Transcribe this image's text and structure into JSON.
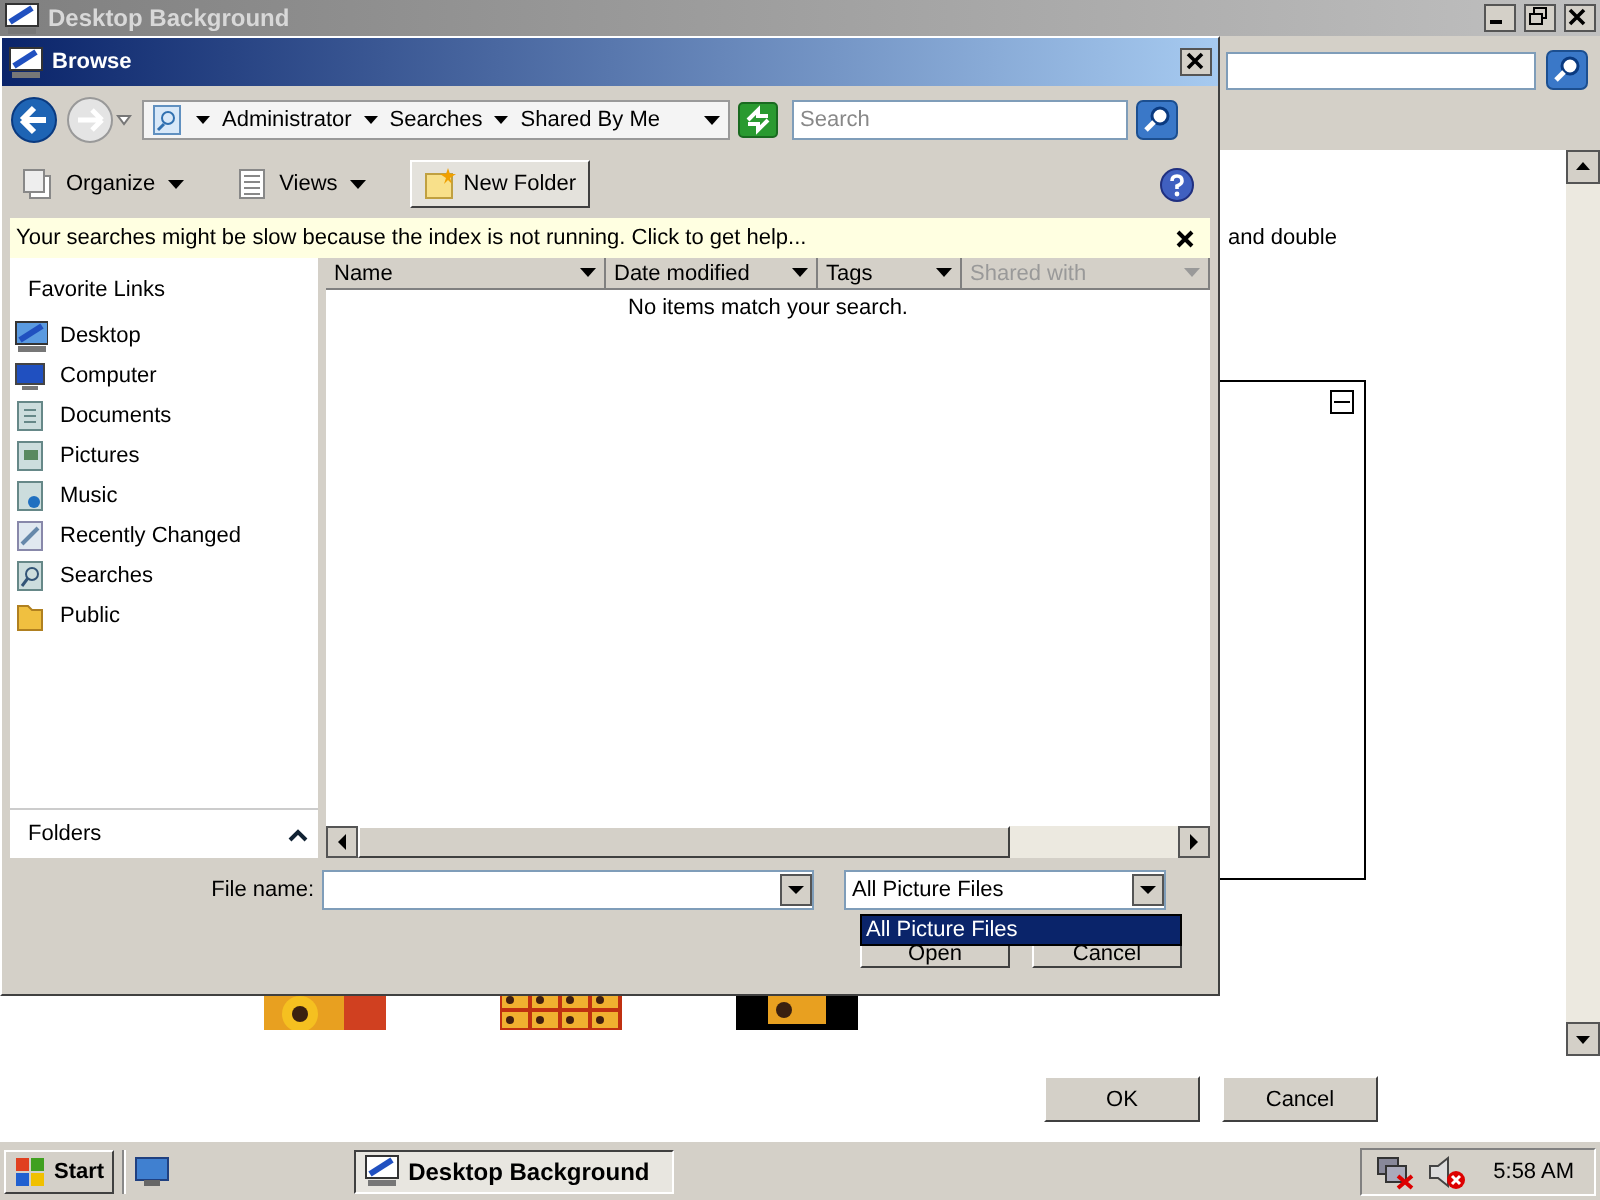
{
  "background_window": {
    "title": "Desktop Background",
    "text_fragment": "and double",
    "thumbnails": [
      {
        "kind": "stretch"
      },
      {
        "kind": "tile"
      },
      {
        "kind": "center"
      }
    ],
    "buttons": [
      {
        "label": "OK"
      },
      {
        "label": "Cancel"
      }
    ]
  },
  "dialog": {
    "title": "Browse",
    "breadcrumb": [
      "Administrator",
      "Searches",
      "Shared By Me"
    ],
    "search": {
      "placeholder": "Search"
    },
    "toolbar": [
      {
        "kind": "menu",
        "label": "Organize"
      },
      {
        "kind": "menu",
        "label": "Views"
      },
      {
        "kind": "button",
        "label": "New Folder"
      }
    ],
    "info_bar": "Your searches might be slow because the index is not running. Click to get help...",
    "favorite_links": {
      "title": "Favorite Links",
      "items": [
        {
          "label": "Desktop"
        },
        {
          "label": "Computer"
        },
        {
          "label": "Documents"
        },
        {
          "label": "Pictures"
        },
        {
          "label": "Music"
        },
        {
          "label": "Recently Changed"
        },
        {
          "label": "Searches"
        },
        {
          "label": "Public"
        }
      ]
    },
    "folders": "Folders",
    "columns": [
      {
        "label": "Name",
        "disabled": false
      },
      {
        "label": "Date modified",
        "disabled": false
      },
      {
        "label": "Tags",
        "disabled": false
      },
      {
        "label": "Shared with",
        "disabled": true
      }
    ],
    "empty_message": "No items match your search.",
    "file_name_label": "File name:",
    "filter": {
      "value": "All Picture Files",
      "expanded": true,
      "options": [
        {
          "label": "All Picture Files",
          "selected": true
        }
      ]
    },
    "buttons": [
      {
        "label": "Open"
      },
      {
        "label": "Cancel"
      }
    ]
  },
  "taskbar": {
    "start": "Start",
    "tasks": [
      {
        "label": "Desktop Background",
        "selected": true
      }
    ],
    "clock": "5:58 AM"
  }
}
